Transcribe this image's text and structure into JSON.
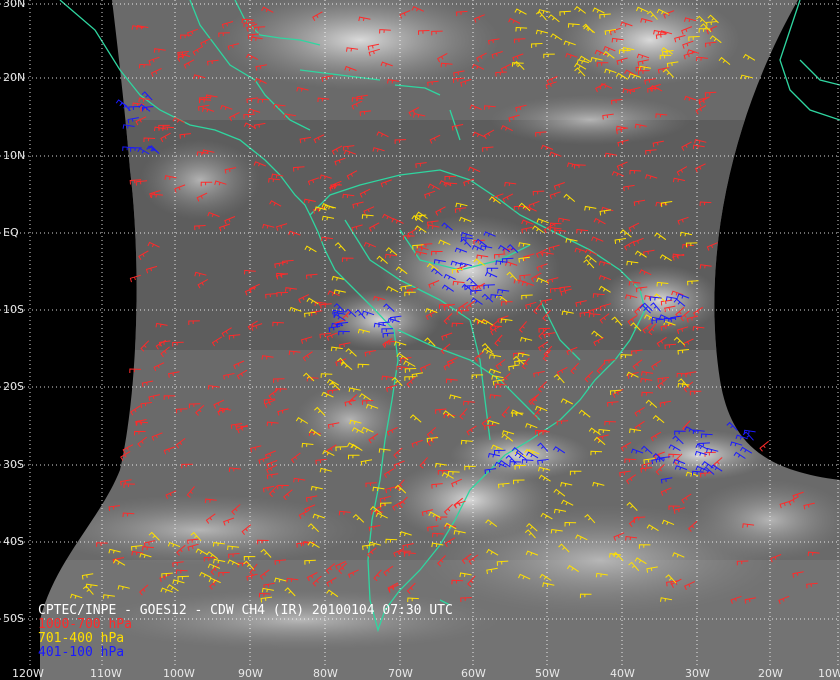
{
  "product": {
    "caption": "CPTEC/INPE - GOES12 - CDW CH4 (IR) 20100104 07:30 UTC"
  },
  "legend": [
    {
      "label": "1000-700 hPa",
      "color": "#ff2a2a"
    },
    {
      "label": "701-400 hPa",
      "color": "#ffe000"
    },
    {
      "label": "401-100 hPa",
      "color": "#1a1aff"
    }
  ],
  "colors": {
    "coastline": "#2fd6a0",
    "grid": "#ffffff",
    "background": "#000000"
  },
  "lat_labels": [
    "30N",
    "20N",
    "10N",
    "EQ",
    "10S",
    "20S",
    "30S",
    "40S",
    "50S"
  ],
  "lon_labels": [
    "120W",
    "110W",
    "100W",
    "90W",
    "80W",
    "70W",
    "60W",
    "50W",
    "40W",
    "30W",
    "20W",
    "10W"
  ]
}
